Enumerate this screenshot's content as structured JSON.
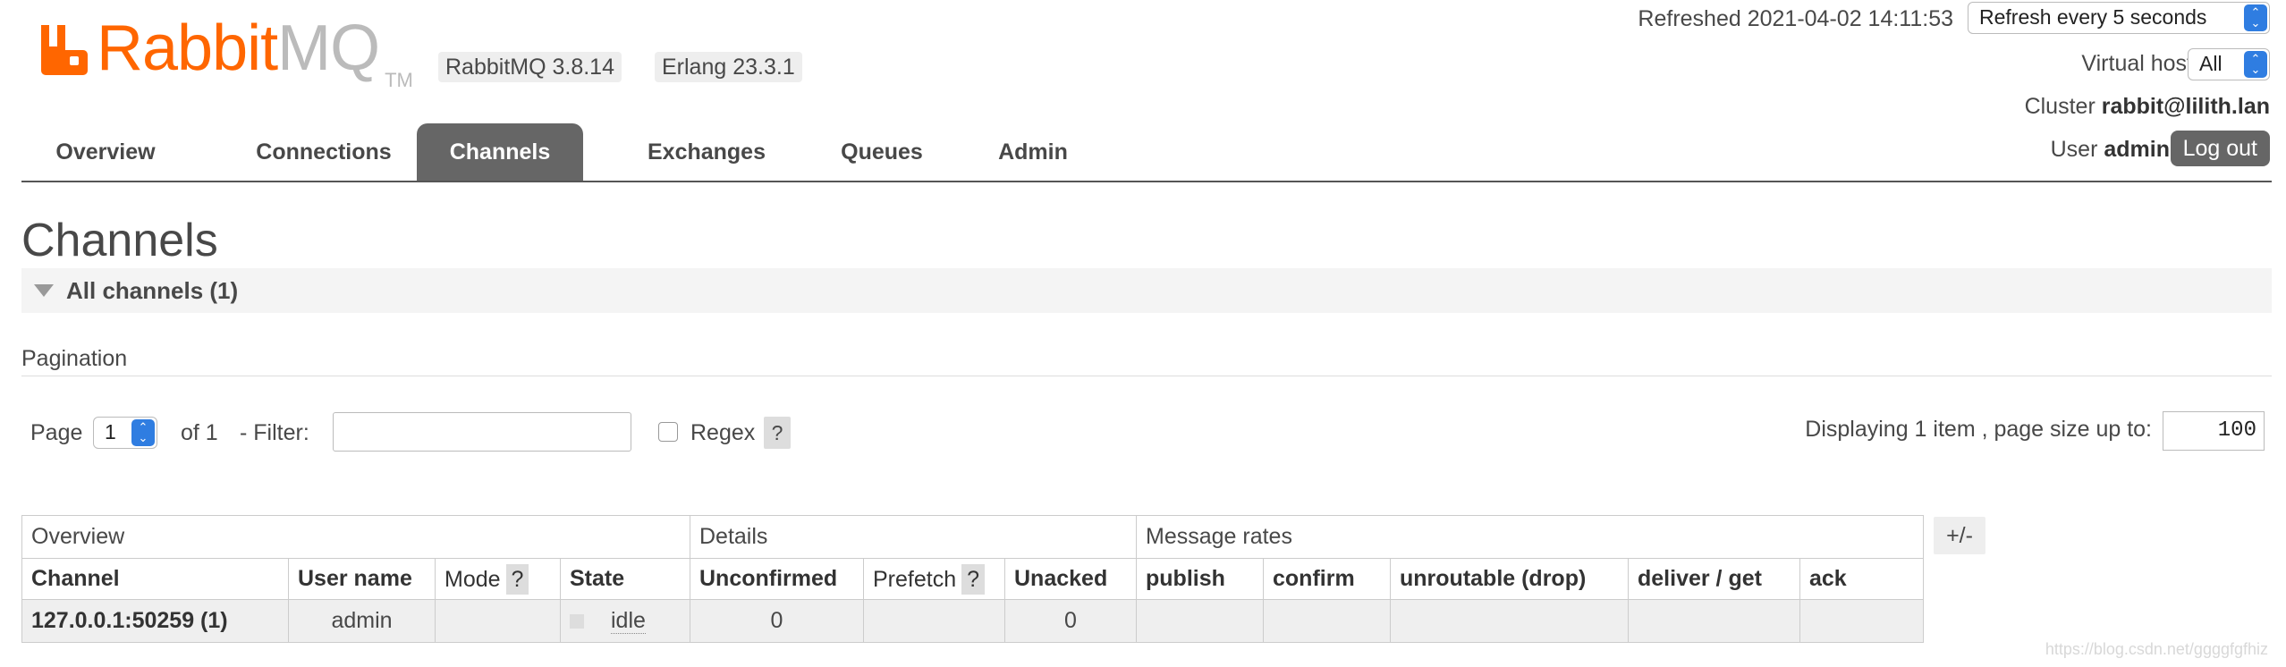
{
  "header": {
    "logo": {
      "name_main": "Rabbit",
      "name_accent": "MQ",
      "trademark": "TM"
    },
    "rabbitmq_version": "RabbitMQ 3.8.14",
    "erlang_version": "Erlang 23.3.1",
    "refreshed": "Refreshed 2021-04-02 14:11:53",
    "refresh_select": "Refresh every 5 seconds",
    "virtual_host_label": "Virtual host",
    "virtual_host_value": "All",
    "cluster_label": "Cluster",
    "cluster_name": "rabbit@lilith.lan",
    "user_label": "User",
    "user_name": "admin",
    "logout_label": "Log out"
  },
  "tabs": [
    {
      "label": "Overview",
      "active": false
    },
    {
      "label": "Connections",
      "active": false
    },
    {
      "label": "Channels",
      "active": true
    },
    {
      "label": "Exchanges",
      "active": false
    },
    {
      "label": "Queues",
      "active": false
    },
    {
      "label": "Admin",
      "active": false
    }
  ],
  "page": {
    "title": "Channels",
    "section_title": "All channels (1)"
  },
  "pagination": {
    "heading": "Pagination",
    "page_label": "Page",
    "page_value": "1",
    "of_label": "of 1",
    "filter_label": "- Filter:",
    "filter_value": "",
    "regex_label": "Regex",
    "help": "?",
    "displaying": "Displaying 1 item , page size up to:",
    "page_size": "100"
  },
  "table": {
    "groups": [
      "Overview",
      "Details",
      "Message rates"
    ],
    "columns": {
      "channel": "Channel",
      "user_name": "User name",
      "mode": "Mode",
      "state": "State",
      "unconfirmed": "Unconfirmed",
      "prefetch": "Prefetch",
      "unacked": "Unacked",
      "publish": "publish",
      "confirm": "confirm",
      "unroutable": "unroutable (drop)",
      "deliver_get": "deliver / get",
      "ack": "ack"
    },
    "help": "?",
    "toggle_columns": "+/-",
    "rows": [
      {
        "channel": "127.0.0.1:50259 (1)",
        "user_name": "admin",
        "mode": "",
        "state": "idle",
        "unconfirmed": "0",
        "prefetch": "",
        "unacked": "0",
        "publish": "",
        "confirm": "",
        "unroutable": "",
        "deliver_get": "",
        "ack": ""
      }
    ]
  },
  "watermark": "https://blog.csdn.net/ggggfgfhiz",
  "colors": {
    "brand_orange": "#ff6600",
    "tab_active": "#666666",
    "select_accent": "#2f7de1"
  }
}
